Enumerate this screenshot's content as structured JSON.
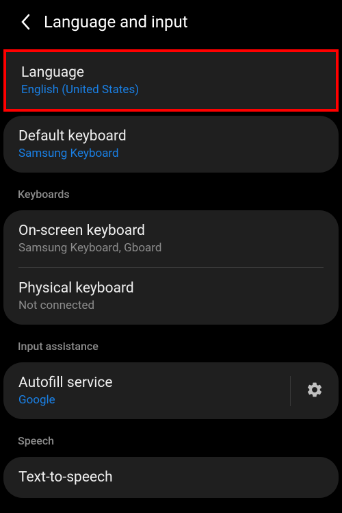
{
  "header": {
    "title": "Language and input"
  },
  "items": {
    "language": {
      "title": "Language",
      "subtitle": "English (United States)"
    },
    "defaultKeyboard": {
      "title": "Default keyboard",
      "subtitle": "Samsung Keyboard"
    },
    "onScreenKeyboard": {
      "title": "On-screen keyboard",
      "subtitle": "Samsung Keyboard, Gboard"
    },
    "physicalKeyboard": {
      "title": "Physical keyboard",
      "subtitle": "Not connected"
    },
    "autofill": {
      "title": "Autofill service",
      "subtitle": "Google"
    },
    "tts": {
      "title": "Text-to-speech"
    }
  },
  "sections": {
    "keyboards": "Keyboards",
    "inputAssistance": "Input assistance",
    "speech": "Speech"
  }
}
